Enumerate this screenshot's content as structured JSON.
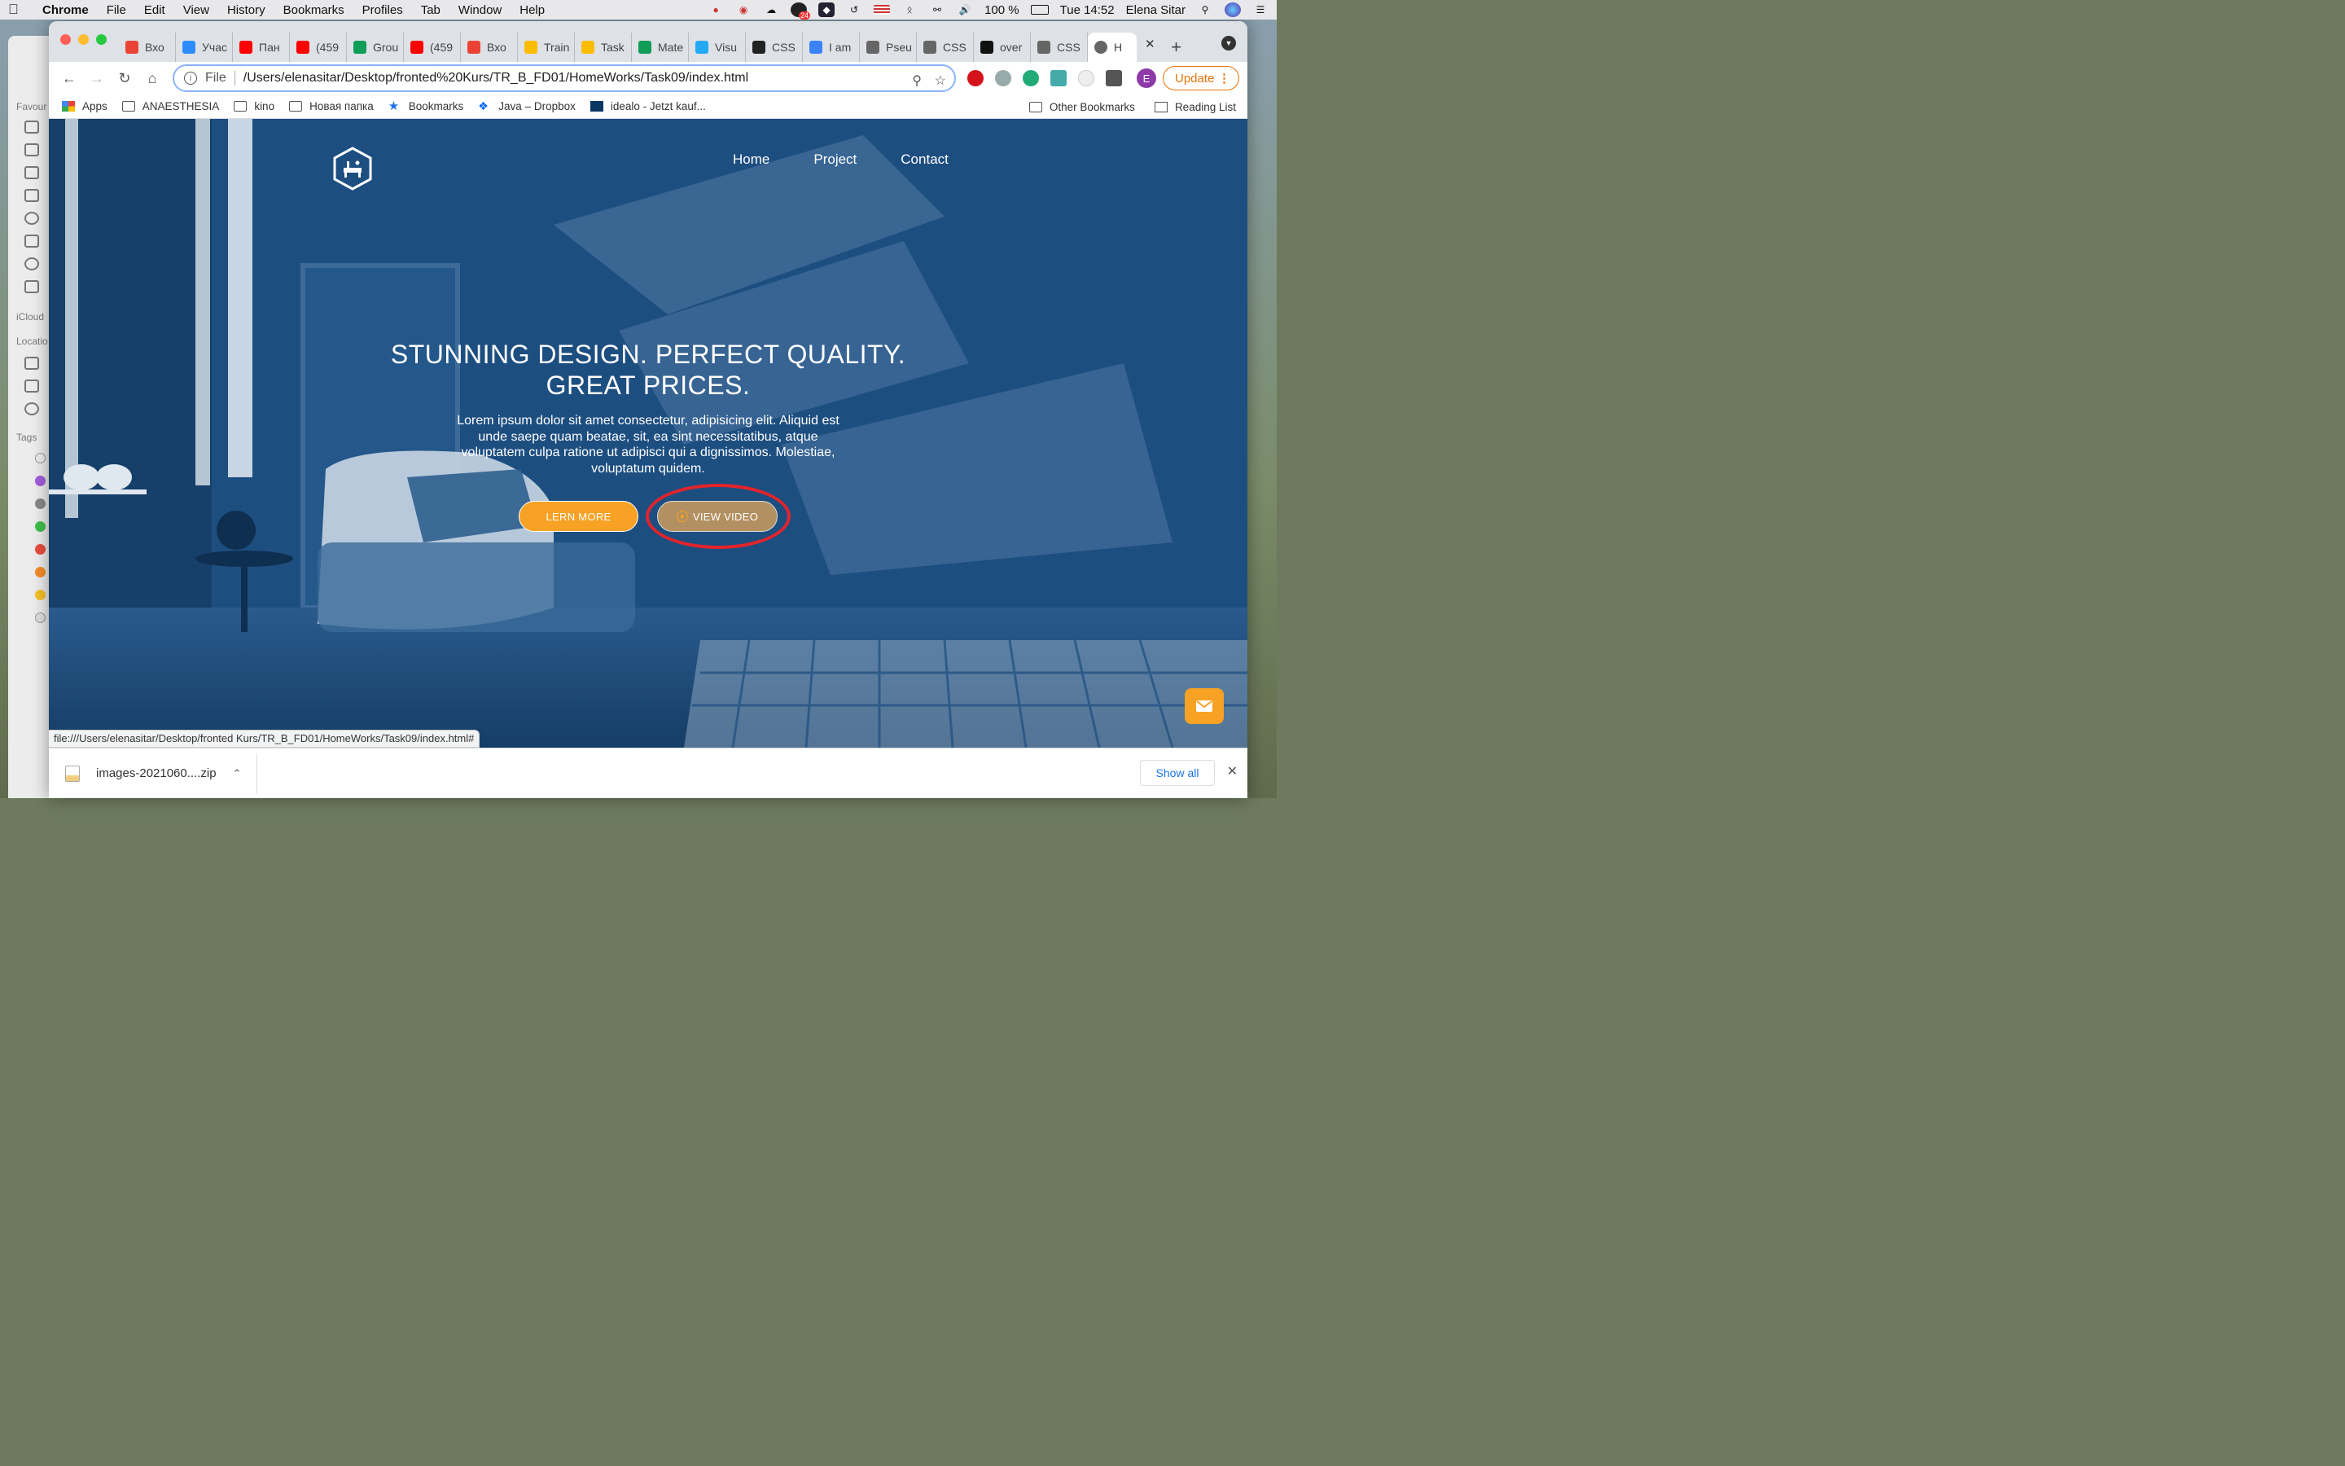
{
  "menubar": {
    "app": "Chrome",
    "items": [
      "File",
      "Edit",
      "View",
      "History",
      "Bookmarks",
      "Profiles",
      "Tab",
      "Window",
      "Help"
    ],
    "badge": "24",
    "battery": "100 %",
    "clock": "Tue 14:52",
    "user": "Elena Sitar"
  },
  "finder": {
    "sections": [
      "Favour",
      "iCloud",
      "Locatio",
      "Tags"
    ]
  },
  "tabs": [
    {
      "label": "Вхо",
      "color": "#ea4335"
    },
    {
      "label": "Учас",
      "color": "#2d8cff"
    },
    {
      "label": "Пан",
      "color": "#ff0000"
    },
    {
      "label": "(459",
      "color": "#ff0000"
    },
    {
      "label": "Grou",
      "color": "#0f9d58"
    },
    {
      "label": "(459",
      "color": "#ff0000"
    },
    {
      "label": "Вхо",
      "color": "#ea4335"
    },
    {
      "label": "Train",
      "color": "#fbbc04"
    },
    {
      "label": "Task",
      "color": "#fbbc04"
    },
    {
      "label": "Mate",
      "color": "#0f9d58"
    },
    {
      "label": "Visu",
      "color": "#23a9f2"
    },
    {
      "label": "CSS",
      "color": "#222222"
    },
    {
      "label": "I am",
      "color": "#3b82f6"
    },
    {
      "label": "Pseu",
      "color": "#666666"
    },
    {
      "label": "CSS",
      "color": "#666666"
    },
    {
      "label": "over",
      "color": "#111111"
    },
    {
      "label": "CSS",
      "color": "#666666"
    }
  ],
  "active_tab": {
    "label": "H"
  },
  "address_bar": {
    "scheme": "File",
    "url": "/Users/elenasitar/Desktop/fronted%20Kurs/TR_B_FD01/HomeWorks/Task09/index.html"
  },
  "profile_initial": "E",
  "update_label": "Update",
  "bookmarks": [
    {
      "label": "Apps",
      "icon": "apps-grid-icon"
    },
    {
      "label": "ANAESTHESIA",
      "icon": "folder-icon"
    },
    {
      "label": "kino",
      "icon": "folder-icon"
    },
    {
      "label": "Новая папка",
      "icon": "folder-icon"
    },
    {
      "label": "Bookmarks",
      "icon": "star-icon"
    },
    {
      "label": "Java – Dropbox",
      "icon": "dropbox-icon"
    },
    {
      "label": "idealo - Jetzt kauf...",
      "icon": "idealo-icon"
    }
  ],
  "bookmarks_right": {
    "other": "Other Bookmarks",
    "reading": "Reading List"
  },
  "site": {
    "nav": [
      "Home",
      "Project",
      "Contact"
    ],
    "headline_line1": "STUNNING DESIGN. PERFECT QUALITY.",
    "headline_line2": "GREAT PRICES.",
    "subtext": "Lorem ipsum dolor sit amet consectetur, adipisicing elit. Aliquid est unde saepe quam beatae, sit, ea sint necessitatibus, atque voluptatem culpa ratione ut adipisci qui a dignissimos. Molestiae, voluptatum quidem.",
    "learn_more": "LERN MORE",
    "view_video": "VIEW VIDEO",
    "colors": {
      "hero": "#1d4e80",
      "accent": "#f7a224",
      "video_btn": "#b39061",
      "highlight_ring": "#e3242b"
    }
  },
  "status_url": "file:///Users/elenasitar/Desktop/fronted Kurs/TR_B_FD01/HomeWorks/Task09/index.html#",
  "download": {
    "file": "images-2021060....zip",
    "show_all": "Show all"
  }
}
